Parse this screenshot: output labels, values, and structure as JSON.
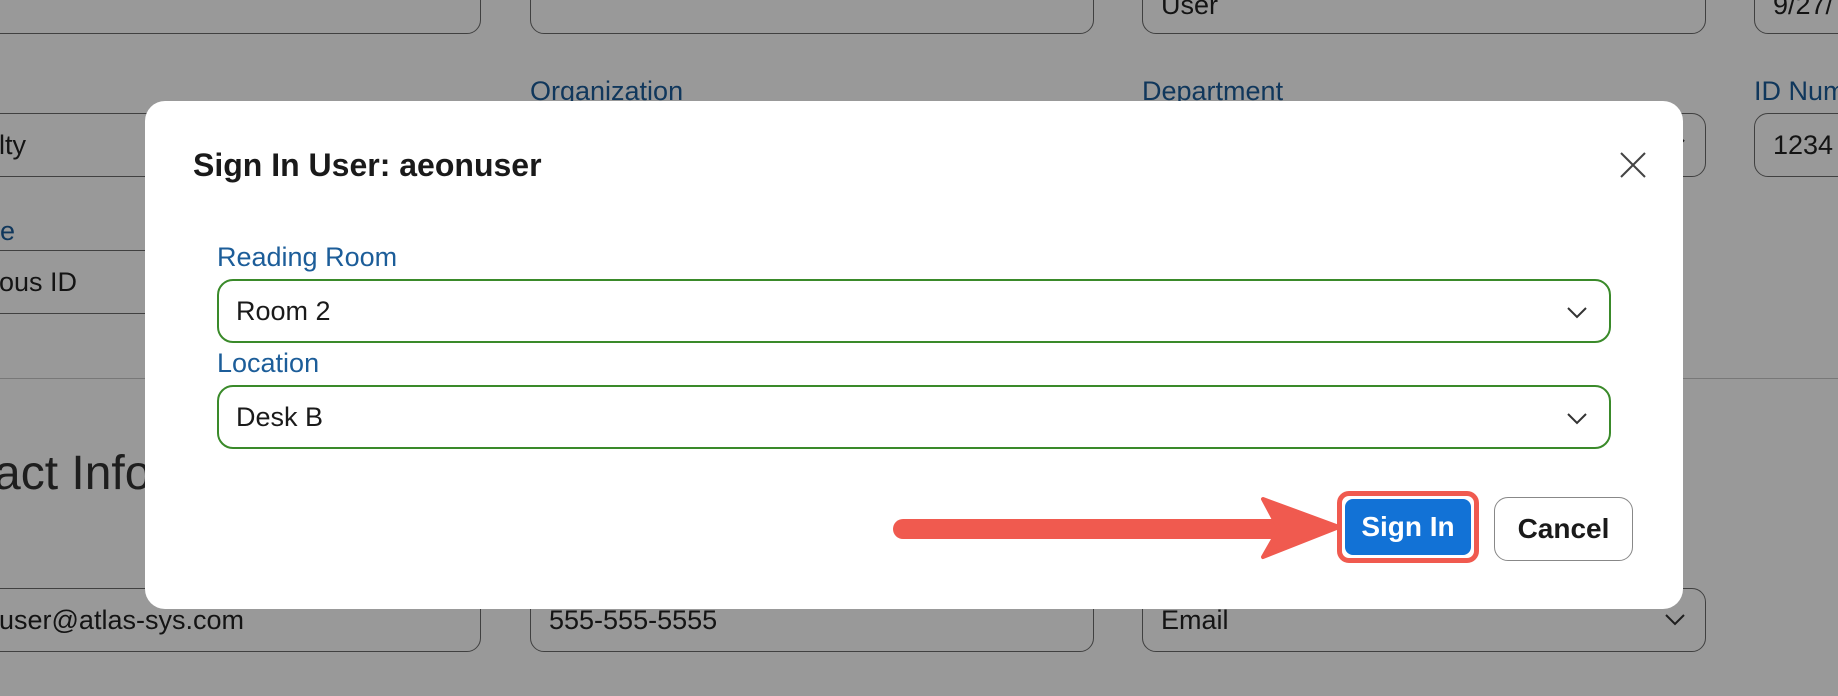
{
  "background": {
    "row1": {
      "col3_value": "User",
      "col4_value": "9/27/"
    },
    "row2": {
      "col1_value": "lty",
      "col2_label": "Organization",
      "col3_label": "Department",
      "col4_label": "ID Num",
      "col4_value": "1234"
    },
    "row3": {
      "col1_label": "e",
      "col1_value": "ous ID"
    },
    "contact_heading": "act Info",
    "row4": {
      "email_value": "user@atlas-sys.com",
      "phone_value": "555-555-5555",
      "method_value": "Email"
    }
  },
  "modal": {
    "title": "Sign In User: aeonuser",
    "close_icon": "close-icon",
    "reading_room": {
      "label": "Reading Room",
      "value": "Room 2"
    },
    "location": {
      "label": "Location",
      "value": "Desk B"
    },
    "sign_in_label": "Sign In",
    "cancel_label": "Cancel"
  },
  "colors": {
    "accent": "#1272d6",
    "label": "#1c5d99",
    "select_border": "#3a8a2a",
    "annotation": "#f05a4f"
  }
}
